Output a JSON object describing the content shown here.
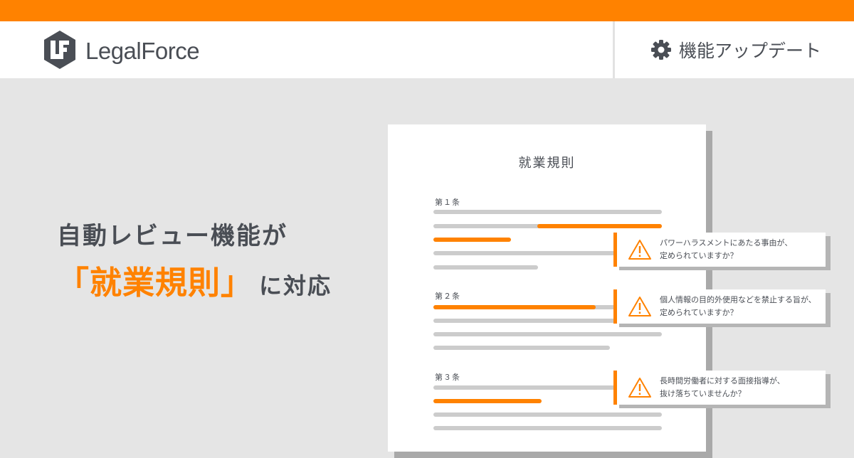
{
  "header": {
    "brand": "LegalForce",
    "update_label": "機能アップデート",
    "update_icon": "gear-icon",
    "logo_icon": "legalforce-logo-icon"
  },
  "headline": {
    "line1": "自動レビュー機能が",
    "highlight": "「就業規則」",
    "tail": "に対応"
  },
  "document": {
    "title": "就業規則",
    "articles": [
      {
        "label": "第１条"
      },
      {
        "label": "第２条"
      },
      {
        "label": "第３条"
      }
    ]
  },
  "callouts": [
    {
      "icon": "warning-icon",
      "line1": "パワーハラスメントにあたる事由が、",
      "line2": "定められていますか？"
    },
    {
      "icon": "warning-icon",
      "line1": "個人情報の目的外使用などを禁止する旨が、",
      "line2": "定められていますか？"
    },
    {
      "icon": "warning-icon",
      "line1": "長時間労働者に対する面接指導が、",
      "line2": "抜け落ちていませんか？"
    }
  ],
  "colors": {
    "accent": "#ff8200",
    "text": "#4a4e55",
    "background": "#e5e5e5",
    "bar": "#cccccc"
  }
}
